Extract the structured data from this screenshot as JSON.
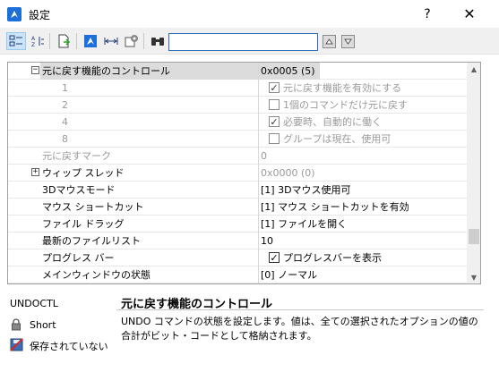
{
  "window": {
    "title": "設定",
    "help": "?",
    "close": "✕"
  },
  "toolbar": {
    "buttons": [
      {
        "name": "categorized-view-icon"
      },
      {
        "name": "alphabetical-sort-icon"
      },
      {
        "name": "export-icon"
      },
      {
        "name": "app-logo-icon"
      },
      {
        "name": "units-icon"
      },
      {
        "name": "drawing-settings-icon"
      },
      {
        "name": "binoculars-icon"
      }
    ],
    "search": {
      "value": "",
      "placeholder": ""
    }
  },
  "grid": {
    "rows": [
      {
        "kind": "group",
        "name": "元に戻す機能のコントロール",
        "value": "0x0005 (5)",
        "expand": "−",
        "selected": true
      },
      {
        "kind": "bit",
        "num": "1",
        "checked": true,
        "label": "元に戻す機能を有効にする"
      },
      {
        "kind": "bit",
        "num": "2",
        "checked": false,
        "label": "1個のコマンドだけ元に戻す"
      },
      {
        "kind": "bit",
        "num": "4",
        "checked": true,
        "label": "必要時、自動的に働く"
      },
      {
        "kind": "bit",
        "num": "8",
        "checked": false,
        "label": "グループは現在、使用可"
      },
      {
        "kind": "plain-grey",
        "name": "元に戻すマーク",
        "value": "0"
      },
      {
        "kind": "group-grey",
        "name": "ウィップ スレッド",
        "value": "0x0000 (0)",
        "expand": "+"
      },
      {
        "kind": "plain",
        "name": "3Dマウスモード",
        "value": "[1] 3Dマウス使用可"
      },
      {
        "kind": "plain",
        "name": "マウス ショートカット",
        "value": "[1] マウス ショートカットを有効"
      },
      {
        "kind": "plain",
        "name": "ファイル ドラッグ",
        "value": "[1] ファイルを開く"
      },
      {
        "kind": "plain",
        "name": "最新のファイルリスト",
        "value": "10"
      },
      {
        "kind": "checkval",
        "name": "プログレス バー",
        "checked": true,
        "label": "プログレスバーを表示"
      },
      {
        "kind": "plain",
        "name": "メインウィンドウの状態",
        "value": "[0] ノーマル"
      }
    ]
  },
  "info": {
    "code": "UNDOCTL",
    "title": "元に戻す機能のコントロール",
    "description": "UNDO コマンドの状態を設定します。値は、全ての選択されたオプションの値の合計がビット・コードとして格納されます。",
    "type": "Short",
    "saved": "保存されていない"
  },
  "colors": {
    "accent": "#1e6fd9",
    "selected_bg": "#dcdcdc",
    "grey_text": "#9a9a9a"
  }
}
